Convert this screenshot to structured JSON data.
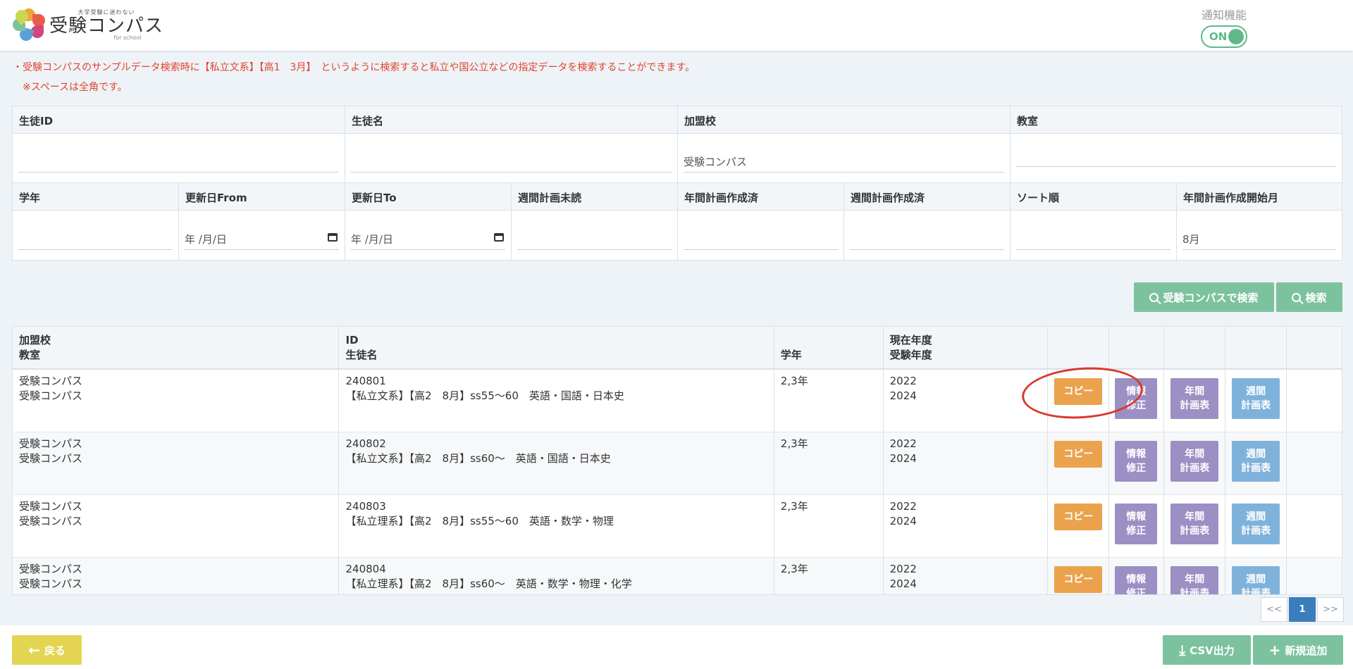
{
  "header": {
    "logo_tagline": "大学受験に迷わない",
    "logo_name": "受験コンパス",
    "logo_sub": "for school",
    "notify_label": "通知機能",
    "notify_toggle": "ON"
  },
  "notice": {
    "line1": "・受験コンパスのサンプルデータ検索時に【私立文系】【高1　3月】　というように検索すると私立や国公立などの指定データを検索することができます。",
    "line2": "　※スペースは全角です。"
  },
  "search": {
    "row1": {
      "student_id_label": "生徒ID",
      "student_name_label": "生徒名",
      "school_label": "加盟校",
      "school_value": "受験コンパス",
      "classroom_label": "教室"
    },
    "row2": {
      "grade_label": "学年",
      "updated_from_label": "更新日From",
      "updated_from_placeholder": "年 /月/日",
      "updated_to_label": "更新日To",
      "updated_to_placeholder": "年 /月/日",
      "weekly_unread_label": "週間計画未読",
      "annual_created_label": "年間計画作成済",
      "weekly_created_label": "週間計画作成済",
      "sort_label": "ソート順",
      "annual_start_label": "年間計画作成開始月",
      "annual_start_value": "8月"
    },
    "compass_search_button": "受験コンパスで検索",
    "search_button": "検索"
  },
  "table": {
    "headers": {
      "col1_line1": "加盟校",
      "col1_line2": "教室",
      "col2_line1": "ID",
      "col2_line2": "生徒名",
      "col3": "学年",
      "col4_line1": "現在年度",
      "col4_line2": "受験年度"
    },
    "rows": [
      {
        "school": "受験コンパス",
        "classroom": "受験コンパス",
        "id": "240801",
        "name": "【私立文系】【高2　8月】ss55〜60　英語・国語・日本史",
        "grade": "2,3年",
        "current_year": "2022",
        "exam_year": "2024"
      },
      {
        "school": "受験コンパス",
        "classroom": "受験コンパス",
        "id": "240802",
        "name": "【私立文系】【高2　8月】ss60〜　英語・国語・日本史",
        "grade": "2,3年",
        "current_year": "2022",
        "exam_year": "2024"
      },
      {
        "school": "受験コンパス",
        "classroom": "受験コンパス",
        "id": "240803",
        "name": "【私立理系】【高2　8月】ss55〜60　英語・数学・物理",
        "grade": "2,3年",
        "current_year": "2022",
        "exam_year": "2024"
      },
      {
        "school": "受験コンパス",
        "classroom": "受験コンパス",
        "id": "240804",
        "name": "【私立理系】【高2　8月】ss60〜　英語・数学・物理・化学",
        "grade": "2,3年",
        "current_year": "2022",
        "exam_year": "2024"
      }
    ],
    "actions": {
      "copy": "コピー",
      "info_line1": "情報",
      "info_line2": "修正",
      "annual_line1": "年間",
      "annual_line2": "計画表",
      "weekly_line1": "週間",
      "weekly_line2": "計画表"
    }
  },
  "pagination": {
    "prev": "<<",
    "current": "1",
    "next": ">>"
  },
  "footer": {
    "back_button": "戻る",
    "csv_button": "CSV出力",
    "new_button": "新規追加"
  },
  "colors": {
    "accent_green": "#7cc29f",
    "copy_orange": "#eba24c",
    "purple": "#9b8fc4",
    "blue": "#7fb2db",
    "back_yellow": "#e3d552",
    "notice_red": "#e2442f",
    "annotation_red": "#d93a2e"
  }
}
